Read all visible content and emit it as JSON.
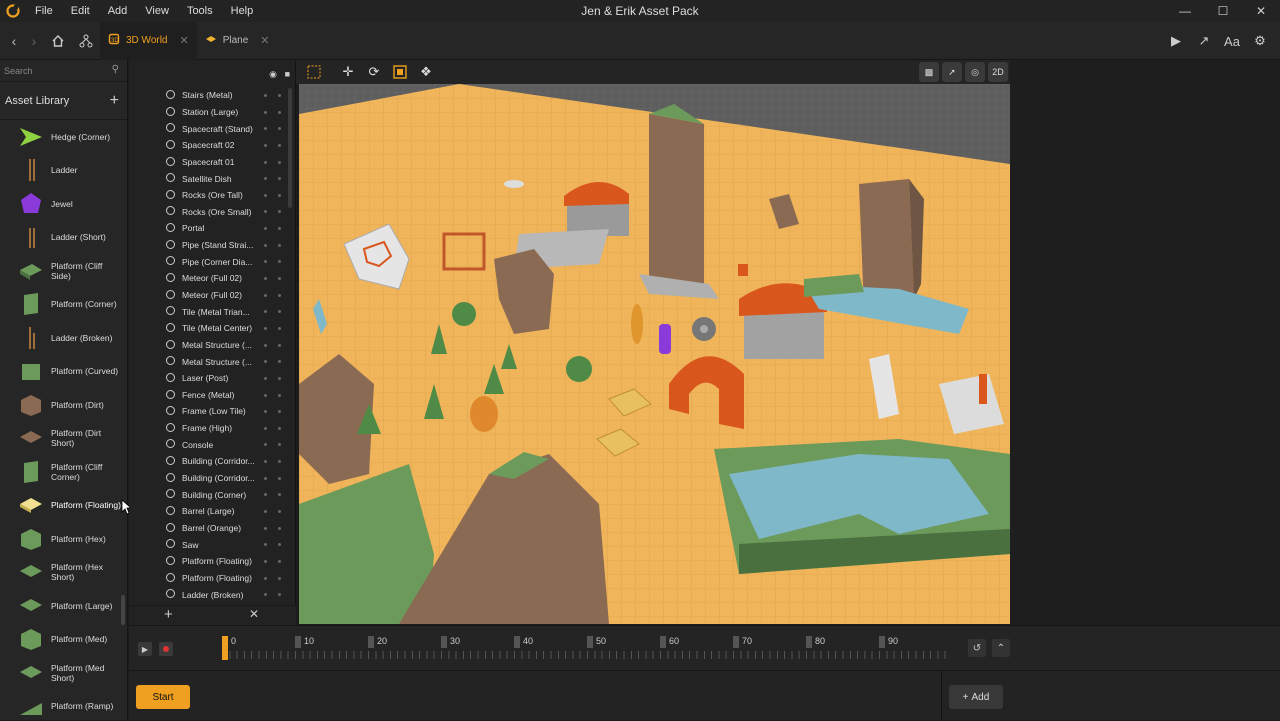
{
  "window": {
    "title": "Jen & Erik Asset Pack",
    "menu": [
      "File",
      "Edit",
      "Add",
      "View",
      "Tools",
      "Help"
    ]
  },
  "tabs": [
    {
      "label": "3D World",
      "active": true
    },
    {
      "label": "Plane",
      "active": false
    }
  ],
  "toolbar_right": {
    "font_label": "Aa"
  },
  "search": {
    "placeholder": "Search"
  },
  "asset_library": {
    "title": "Asset Library",
    "items": [
      {
        "label": "Hedge (Corner)",
        "icon": "hedge-corner"
      },
      {
        "label": "Ladder",
        "icon": "ladder"
      },
      {
        "label": "Jewel",
        "icon": "jewel"
      },
      {
        "label": "Ladder (Short)",
        "icon": "ladder-short"
      },
      {
        "label": "Platform (Cliff Side)",
        "icon": "platform-cliff-side"
      },
      {
        "label": "Platform (Corner)",
        "icon": "platform-corner"
      },
      {
        "label": "Ladder (Broken)",
        "icon": "ladder-broken"
      },
      {
        "label": "Platform (Curved)",
        "icon": "platform-curved"
      },
      {
        "label": "Platform (Dirt)",
        "icon": "platform-dirt"
      },
      {
        "label": "Platform (Dirt Short)",
        "icon": "platform-dirt-short"
      },
      {
        "label": "Platform (Cliff Corner)",
        "icon": "platform-cliff-corner"
      },
      {
        "label": "Platform (Floating)",
        "icon": "platform-floating"
      },
      {
        "label": "Platform (Hex)",
        "icon": "platform-hex"
      },
      {
        "label": "Platform (Hex Short)",
        "icon": "platform-hex-short"
      },
      {
        "label": "Platform (Large)",
        "icon": "platform-large"
      },
      {
        "label": "Platform (Med)",
        "icon": "platform-med"
      },
      {
        "label": "Platform (Med Short)",
        "icon": "platform-med-short"
      },
      {
        "label": "Platform (Ramp)",
        "icon": "platform-ramp"
      }
    ]
  },
  "scene_objects": [
    "Stairs (Metal)",
    "Station (Large)",
    "Spacecraft (Stand)",
    "Spacecraft 02",
    "Spacecraft 01",
    "Satellite Dish",
    "Rocks (Ore Tall)",
    "Rocks (Ore Small)",
    "Portal",
    "Pipe (Stand Strai...",
    "Pipe (Corner Dia...",
    "Meteor (Full 02)",
    "Meteor (Full 02)",
    "Tile (Metal Trian...",
    "Tile (Metal Center)",
    "Metal Structure (...",
    "Metal Structure (...",
    "Laser (Post)",
    "Fence (Metal)",
    "Frame (Low Tile)",
    "Frame (High)",
    "Console",
    "Building (Corridor...",
    "Building (Corridor...",
    "Building (Corner)",
    "Barrel (Large)",
    "Barrel (Orange)",
    "Saw",
    "Platform (Floating)",
    "Platform (Floating)",
    "Ladder (Broken)"
  ],
  "viewport_toolbar": {
    "mode_2d": "2D"
  },
  "timeline": {
    "ticks": [
      "0",
      "10",
      "20",
      "30",
      "40",
      "50",
      "60",
      "70",
      "80",
      "90"
    ]
  },
  "bottom": {
    "start_label": "Start",
    "add_label": "Add"
  },
  "colors": {
    "accent": "#f0a020",
    "ground": "#f0b55a",
    "grass": "#6c9a5a",
    "rock": "#8a6a52",
    "water": "#7fb8c8",
    "roof": "#d9561d"
  }
}
